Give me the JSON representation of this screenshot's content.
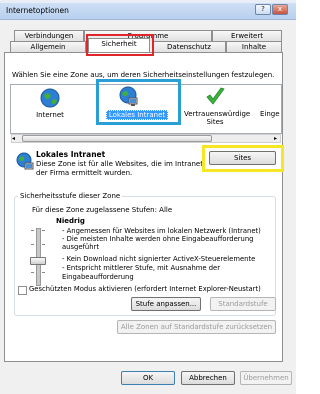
{
  "window": {
    "title": "Internetoptionen",
    "help_label": "?",
    "close_label": "x"
  },
  "tabs": [
    {
      "label": "Verbindungen"
    },
    {
      "label": "Programme"
    },
    {
      "label": "Erweitert"
    },
    {
      "label": "Allgemein"
    },
    {
      "label": "Sicherheit"
    },
    {
      "label": "Datenschutz"
    },
    {
      "label": "Inhalte"
    }
  ],
  "zones": {
    "prompt": "Wählen Sie eine Zone aus, um deren Sicherheitseinstellungen festzulegen.",
    "items": [
      {
        "label": "Internet",
        "icon": "globe-icon"
      },
      {
        "label": "Lokales Intranet",
        "icon": "intranet-icon",
        "selected": true
      },
      {
        "label": "Vertrauenswürdige Sites",
        "icon": "checkmark-icon"
      },
      {
        "label": "Einge",
        "icon": "restricted-icon"
      }
    ]
  },
  "zone_info": {
    "title": "Lokales Intranet",
    "description_line1": "Diese Zone ist für alle Websites, die im Intranet",
    "description_line2": "der Firma ermittelt wurden.",
    "sites_button": "Sites"
  },
  "security_level": {
    "group_title": "Sicherheitsstufe dieser Zone",
    "allowed_levels": "Für diese Zone zugelassene Stufen: Alle",
    "level_name": "Niedrig",
    "lines": [
      "- Angemessen für Websites im lokalen Netzwerk (Intranet)",
      "- Die meisten Inhalte werden ohne Eingabeaufforderung",
      "ausgeführt",
      "- Kein Download nicht signierter ActiveX-Steuerelemente",
      "- Entspricht mittlerer Stufe, mit Ausnahme der",
      "Eingabeaufforderung"
    ],
    "protected_mode_label": "Geschützten Modus aktivieren (erfordert Internet Explorer-Neustart)",
    "custom_level_button": "Stufe anpassen...",
    "default_level_button": "Standardstufe",
    "reset_all_button": "Alle Zonen auf Standardstufe zurücksetzen"
  },
  "footer": {
    "ok_button": "OK",
    "cancel_button": "Abbrechen",
    "apply_button": "Übernehmen"
  },
  "colors": {
    "highlight_red": "#e0262b",
    "highlight_blue": "#2a9fd6",
    "highlight_yellow": "#f6e623",
    "selection": "#3399ff"
  }
}
